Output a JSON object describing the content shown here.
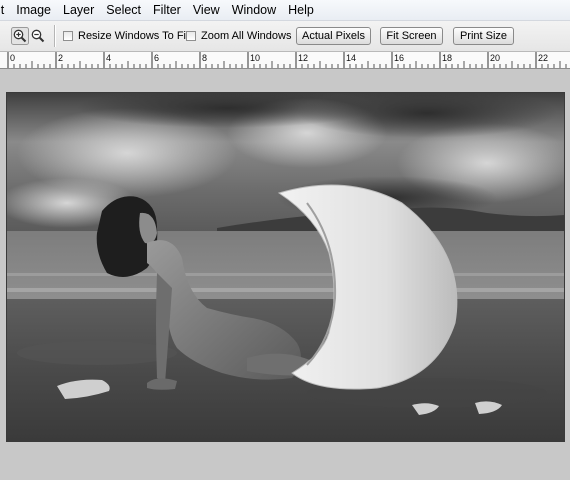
{
  "menu": {
    "items": [
      "it",
      "Image",
      "Layer",
      "Select",
      "Filter",
      "View",
      "Window",
      "Help"
    ]
  },
  "options_bar": {
    "zoom_in_icon": "zoom-in-icon",
    "zoom_out_icon": "zoom-out-icon",
    "resize_windows_label": "Resize Windows To Fit",
    "resize_windows_checked": false,
    "zoom_all_label": "Zoom All Windows",
    "zoom_all_checked": false,
    "actual_pixels_label": "Actual Pixels",
    "fit_screen_label": "Fit Screen",
    "print_size_label": "Print Size"
  },
  "ruler": {
    "labels": [
      "0",
      "2",
      "4",
      "6",
      "8",
      "10",
      "12",
      "14",
      "16",
      "18",
      "20",
      "22"
    ]
  },
  "document": {
    "description_icon": "photo-canvas"
  },
  "colors": {
    "menubar": "#eef1f6",
    "toolbar": "#ececec",
    "workspace": "#c8c8c8"
  }
}
